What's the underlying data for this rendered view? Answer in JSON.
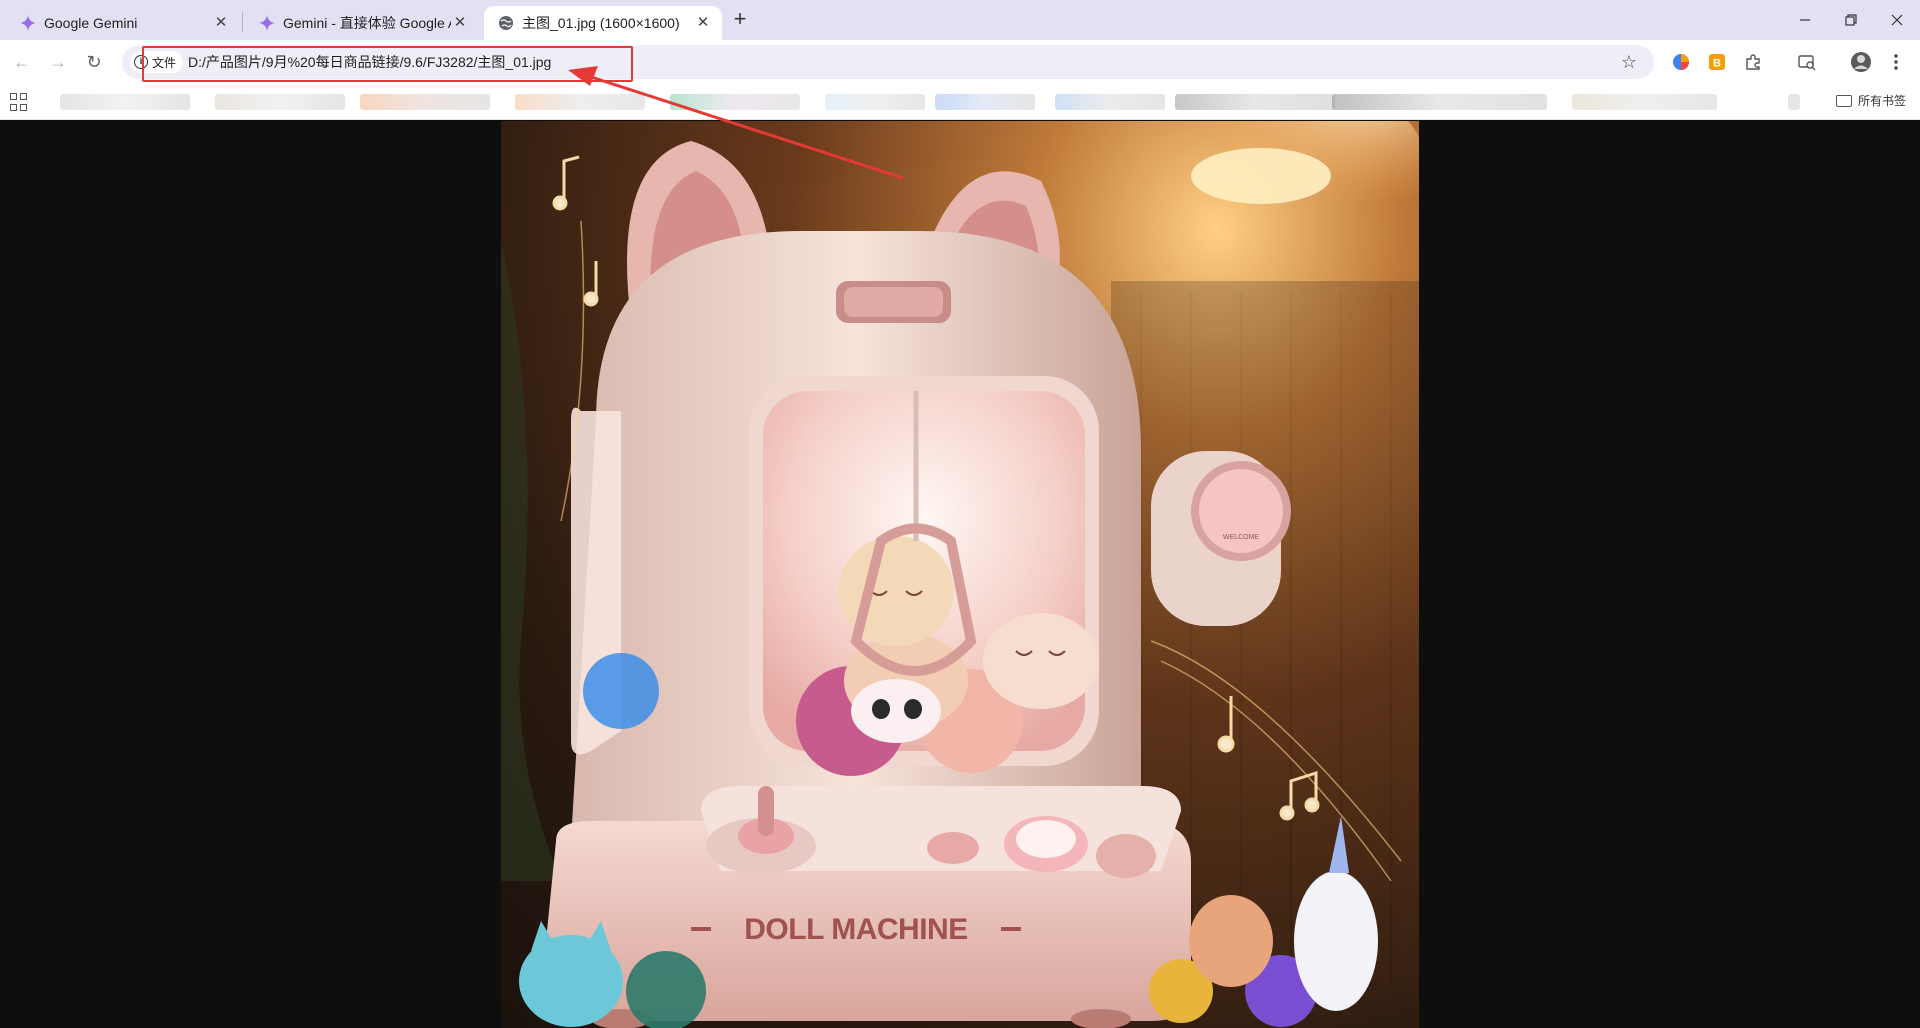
{
  "tabs": [
    {
      "title": "Google Gemini",
      "icon": "gemini-icon"
    },
    {
      "title": "Gemini - 直接体验 Google AI",
      "icon": "gemini-icon"
    },
    {
      "title": "主图_01.jpg (1600×1600)",
      "icon": "globe-icon",
      "active": true
    }
  ],
  "omnibox": {
    "chip_label": "文件",
    "url": "D:/产品图片/9月%20每日商品链接/9.6/FJ3282/主图_01.jpg"
  },
  "bookmarks": {
    "all_label": "所有书签"
  },
  "image": {
    "product_text": "DOLL MACHINE",
    "badge_text": "WELCOME"
  },
  "colors": {
    "tab_strip": "#e4e0f4",
    "highlight_box": "#e53935",
    "machine_body": "#f1dcd2",
    "machine_pink": "#e9a8a8"
  }
}
